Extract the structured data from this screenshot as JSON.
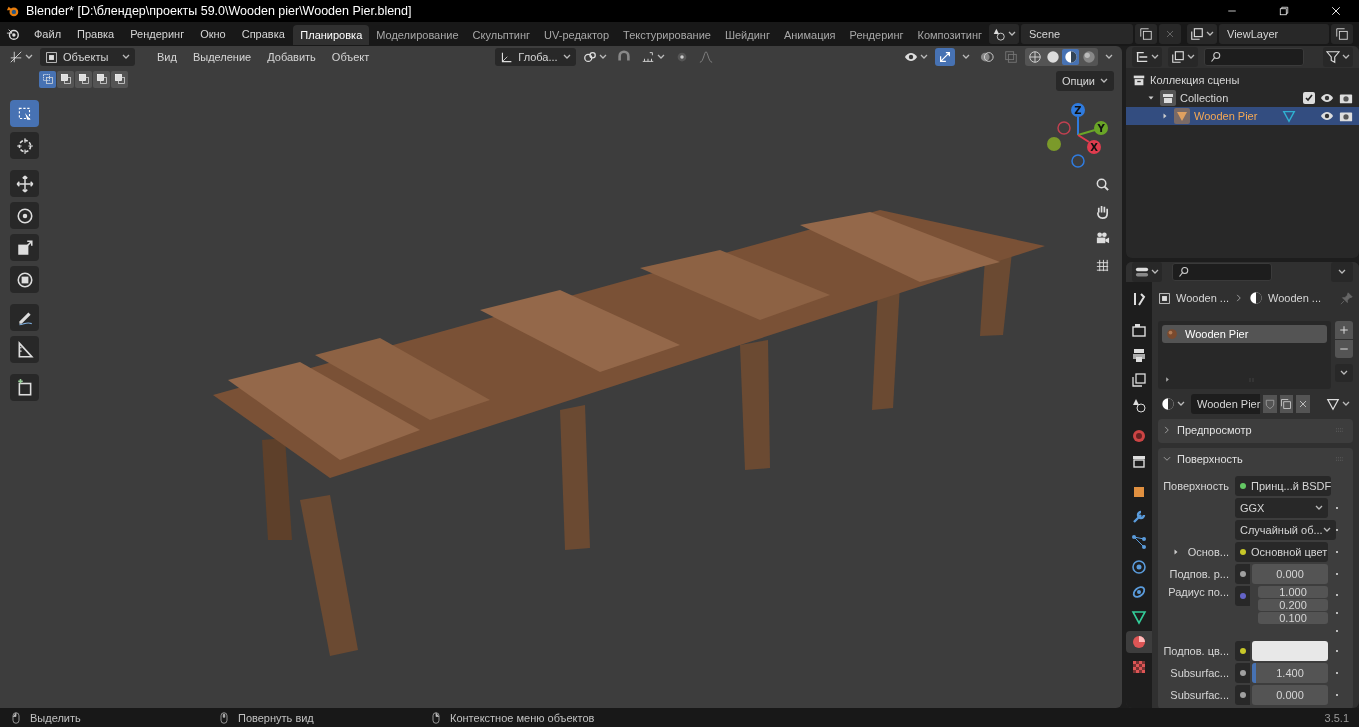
{
  "window": {
    "title": "Blender* [D:\\блендер\\проекты 59.0\\Wooden pier\\Wooden Pier.blend]"
  },
  "menu": [
    "Файл",
    "Правка",
    "Рендеринг",
    "Окно",
    "Справка"
  ],
  "workspaces": [
    {
      "label": "Планировка",
      "selected": true
    },
    {
      "label": "Моделирование",
      "selected": false
    },
    {
      "label": "Скульптинг",
      "selected": false
    },
    {
      "label": "UV-редактор",
      "selected": false
    },
    {
      "label": "Текстурирование",
      "selected": false
    },
    {
      "label": "Шейдинг",
      "selected": false
    },
    {
      "label": "Анимация",
      "selected": false
    },
    {
      "label": "Рендеринг",
      "selected": false
    },
    {
      "label": "Композитинг",
      "selected": false
    }
  ],
  "scene": "Scene",
  "view_layer": "ViewLayer",
  "viewport": {
    "mode": "Объекты",
    "menu": [
      "Вид",
      "Выделение",
      "Добавить",
      "Объект"
    ],
    "orientation": "Глоба...",
    "options": "Опции",
    "select_modes": [
      {
        "selected": true
      },
      {
        "selected": false
      },
      {
        "selected": false
      },
      {
        "selected": false
      },
      {
        "selected": false
      }
    ],
    "tools": [
      {
        "kind": "select",
        "selected": true
      },
      {
        "kind": "cursor",
        "selected": false
      },
      {
        "kind": "move",
        "selected": false
      },
      {
        "kind": "rotate",
        "selected": false
      },
      {
        "kind": "scale",
        "selected": false
      },
      {
        "kind": "transform",
        "selected": false
      },
      {
        "kind": "annotate",
        "selected": false
      },
      {
        "kind": "measure",
        "selected": false
      },
      {
        "kind": "add-cube",
        "selected": false
      }
    ],
    "shading": [
      {
        "kind": "wireframe",
        "selected": false
      },
      {
        "kind": "solid",
        "selected": false
      },
      {
        "kind": "material",
        "selected": true
      },
      {
        "kind": "rendered",
        "selected": false
      }
    ],
    "gizmo_axes": [
      "Z",
      "Y",
      "X"
    ]
  },
  "outliner": {
    "items": [
      {
        "label": "Коллекция сцены",
        "kind": "scene-collection",
        "selected": false,
        "children": [
          {
            "label": "Collection",
            "kind": "collection",
            "selected": false,
            "expanded": true,
            "checked": true,
            "children": [
              {
                "label": "Wooden Pier",
                "kind": "mesh-object",
                "selected": true,
                "expanded": false
              }
            ]
          }
        ]
      }
    ]
  },
  "properties": {
    "tabs": [
      {
        "kind": "tool",
        "selected": false
      },
      {
        "kind": "render",
        "selected": false
      },
      {
        "kind": "output",
        "selected": false
      },
      {
        "kind": "view-layer",
        "selected": false
      },
      {
        "kind": "scene",
        "selected": false
      },
      {
        "kind": "world",
        "selected": false
      },
      {
        "kind": "collection",
        "selected": false
      },
      {
        "kind": "object",
        "selected": false
      },
      {
        "kind": "modifiers",
        "selected": false
      },
      {
        "kind": "particles",
        "selected": false
      },
      {
        "kind": "physics",
        "selected": false
      },
      {
        "kind": "constraints",
        "selected": false
      },
      {
        "kind": "data",
        "selected": false
      },
      {
        "kind": "material",
        "selected": true
      },
      {
        "kind": "texture",
        "selected": false
      }
    ],
    "breadcrumb": [
      "Wooden ...",
      "Wooden ..."
    ],
    "slots": [
      {
        "label": "Wooden Pier",
        "selected": true
      }
    ],
    "material": "Wooden Pier",
    "panels": [
      {
        "label": "Предпросмотр",
        "expanded": false
      },
      {
        "label": "Поверхность",
        "expanded": true
      }
    ],
    "rows": [
      {
        "kind": "socket",
        "label": "Поверхность",
        "color": "#63c763",
        "value": "Принц...й BSDF"
      },
      {
        "kind": "dropdown",
        "value": "GGX"
      },
      {
        "kind": "dropdown",
        "value": "Случайный об..."
      },
      {
        "kind": "socket",
        "label": "Основ...",
        "expanded": false,
        "color": "#c7c729",
        "value": "Основной цвет"
      },
      {
        "kind": "number",
        "label": "Подпов. р...",
        "color": "#a1a1a1",
        "value": "0.000"
      },
      {
        "kind": "vector",
        "label": "Радиус по...",
        "color": "#6363c7",
        "values": [
          "1.000",
          "0.200",
          "0.100"
        ]
      },
      {
        "kind": "swatch",
        "label": "Подпов. цв...",
        "color": "#c7c729"
      },
      {
        "kind": "slider",
        "label": "Subsurfac...",
        "color": "#a1a1a1",
        "value": "1.400",
        "level": 0.05
      },
      {
        "kind": "number",
        "label": "Subsurfac...",
        "color": "#a1a1a1",
        "value": "0.000"
      }
    ]
  },
  "status_bar": {
    "hints": [
      "Выделить",
      "Повернуть вид",
      "Контекстное меню объектов"
    ],
    "version": "3.5.1"
  }
}
